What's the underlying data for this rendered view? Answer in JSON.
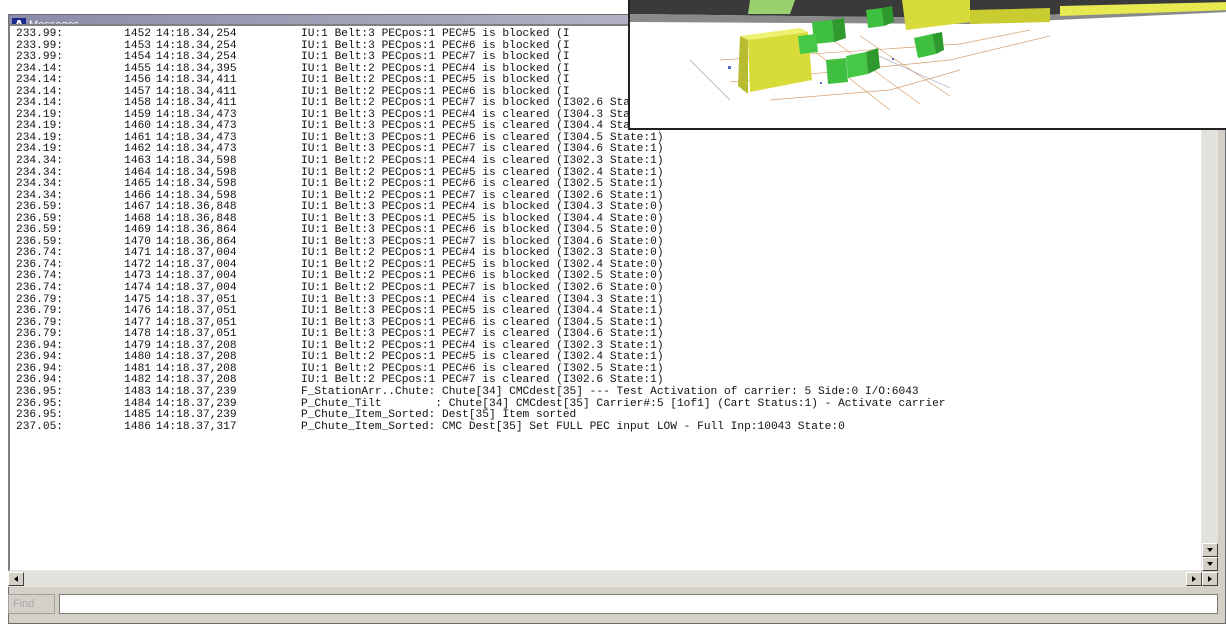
{
  "window": {
    "title": "Messages",
    "app_icon": "Λ"
  },
  "log": {
    "lines": [
      {
        "t": "233.99:",
        "n": "1452",
        "ts": "14:18.34,254",
        "msg": "IU:1 Belt:3 PECpos:1 PEC#5 is blocked (I"
      },
      {
        "t": "233.99:",
        "n": "1453",
        "ts": "14:18.34,254",
        "msg": "IU:1 Belt:3 PECpos:1 PEC#6 is blocked (I"
      },
      {
        "t": "233.99:",
        "n": "1454",
        "ts": "14:18.34,254",
        "msg": "IU:1 Belt:3 PECpos:1 PEC#7 is blocked (I"
      },
      {
        "t": "234.14:",
        "n": "1455",
        "ts": "14:18.34,395",
        "msg": "IU:1 Belt:2 PECpos:1 PEC#4 is blocked (I"
      },
      {
        "t": "234.14:",
        "n": "1456",
        "ts": "14:18.34,411",
        "msg": "IU:1 Belt:2 PECpos:1 PEC#5 is blocked (I"
      },
      {
        "t": "234.14:",
        "n": "1457",
        "ts": "14:18.34,411",
        "msg": "IU:1 Belt:2 PECpos:1 PEC#6 is blocked (I"
      },
      {
        "t": "234.14:",
        "n": "1458",
        "ts": "14:18.34,411",
        "msg": "IU:1 Belt:2 PECpos:1 PEC#7 is blocked (I302.6 State:0)"
      },
      {
        "t": "234.19:",
        "n": "1459",
        "ts": "14:18.34,473",
        "msg": "IU:1 Belt:3 PECpos:1 PEC#4 is cleared (I304.3 State:1)"
      },
      {
        "t": "234.19:",
        "n": "1460",
        "ts": "14:18.34,473",
        "msg": "IU:1 Belt:3 PECpos:1 PEC#5 is cleared (I304.4 State:1)"
      },
      {
        "t": "234.19:",
        "n": "1461",
        "ts": "14:18.34,473",
        "msg": "IU:1 Belt:3 PECpos:1 PEC#6 is cleared (I304.5 State:1)"
      },
      {
        "t": "234.19:",
        "n": "1462",
        "ts": "14:18.34,473",
        "msg": "IU:1 Belt:3 PECpos:1 PEC#7 is cleared (I304.6 State:1)"
      },
      {
        "t": "234.34:",
        "n": "1463",
        "ts": "14:18.34,598",
        "msg": "IU:1 Belt:2 PECpos:1 PEC#4 is cleared (I302.3 State:1)"
      },
      {
        "t": "234.34:",
        "n": "1464",
        "ts": "14:18.34,598",
        "msg": "IU:1 Belt:2 PECpos:1 PEC#5 is cleared (I302.4 State:1)"
      },
      {
        "t": "234.34:",
        "n": "1465",
        "ts": "14:18.34,598",
        "msg": "IU:1 Belt:2 PECpos:1 PEC#6 is cleared (I302.5 State:1)"
      },
      {
        "t": "234.34:",
        "n": "1466",
        "ts": "14:18.34,598",
        "msg": "IU:1 Belt:2 PECpos:1 PEC#7 is cleared (I302.6 State:1)"
      },
      {
        "t": "236.59:",
        "n": "1467",
        "ts": "14:18.36,848",
        "msg": "IU:1 Belt:3 PECpos:1 PEC#4 is blocked (I304.3 State:0)"
      },
      {
        "t": "236.59:",
        "n": "1468",
        "ts": "14:18.36,848",
        "msg": "IU:1 Belt:3 PECpos:1 PEC#5 is blocked (I304.4 State:0)"
      },
      {
        "t": "236.59:",
        "n": "1469",
        "ts": "14:18.36,864",
        "msg": "IU:1 Belt:3 PECpos:1 PEC#6 is blocked (I304.5 State:0)"
      },
      {
        "t": "236.59:",
        "n": "1470",
        "ts": "14:18.36,864",
        "msg": "IU:1 Belt:3 PECpos:1 PEC#7 is blocked (I304.6 State:0)"
      },
      {
        "t": "236.74:",
        "n": "1471",
        "ts": "14:18.37,004",
        "msg": "IU:1 Belt:2 PECpos:1 PEC#4 is blocked (I302.3 State:0)"
      },
      {
        "t": "236.74:",
        "n": "1472",
        "ts": "14:18.37,004",
        "msg": "IU:1 Belt:2 PECpos:1 PEC#5 is blocked (I302.4 State:0)"
      },
      {
        "t": "236.74:",
        "n": "1473",
        "ts": "14:18.37,004",
        "msg": "IU:1 Belt:2 PECpos:1 PEC#6 is blocked (I302.5 State:0)"
      },
      {
        "t": "236.74:",
        "n": "1474",
        "ts": "14:18.37,004",
        "msg": "IU:1 Belt:2 PECpos:1 PEC#7 is blocked (I302.6 State:0)"
      },
      {
        "t": "236.79:",
        "n": "1475",
        "ts": "14:18.37,051",
        "msg": "IU:1 Belt:3 PECpos:1 PEC#4 is cleared (I304.3 State:1)"
      },
      {
        "t": "236.79:",
        "n": "1476",
        "ts": "14:18.37,051",
        "msg": "IU:1 Belt:3 PECpos:1 PEC#5 is cleared (I304.4 State:1)"
      },
      {
        "t": "236.79:",
        "n": "1477",
        "ts": "14:18.37,051",
        "msg": "IU:1 Belt:3 PECpos:1 PEC#6 is cleared (I304.5 State:1)"
      },
      {
        "t": "236.79:",
        "n": "1478",
        "ts": "14:18.37,051",
        "msg": "IU:1 Belt:3 PECpos:1 PEC#7 is cleared (I304.6 State:1)"
      },
      {
        "t": "236.94:",
        "n": "1479",
        "ts": "14:18.37,208",
        "msg": "IU:1 Belt:2 PECpos:1 PEC#4 is cleared (I302.3 State:1)"
      },
      {
        "t": "236.94:",
        "n": "1480",
        "ts": "14:18.37,208",
        "msg": "IU:1 Belt:2 PECpos:1 PEC#5 is cleared (I302.4 State:1)"
      },
      {
        "t": "236.94:",
        "n": "1481",
        "ts": "14:18.37,208",
        "msg": "IU:1 Belt:2 PECpos:1 PEC#6 is cleared (I302.5 State:1)"
      },
      {
        "t": "236.94:",
        "n": "1482",
        "ts": "14:18.37,208",
        "msg": "IU:1 Belt:2 PECpos:1 PEC#7 is cleared (I302.6 State:1)"
      },
      {
        "t": "236.95:",
        "n": "1483",
        "ts": "14:18.37,239",
        "msg": "F_StationArr..Chute: Chute[34] CMCdest[35] --- Test Activation of carrier: 5 Side:0 I/O:6043"
      },
      {
        "t": "236.95:",
        "n": "1484",
        "ts": "14:18.37,239",
        "msg": "P_Chute_Tilt        : Chute[34] CMCdest[35] Carrier#:5 [1of1] (Cart Status:1) - Activate carrier"
      },
      {
        "t": "236.95:",
        "n": "1485",
        "ts": "14:18.37,239",
        "msg": "P_Chute_Item_Sorted: Dest[35] Item sorted"
      },
      {
        "t": "237.05:",
        "n": "1486",
        "ts": "14:18.37,317",
        "msg": "P_Chute_Item_Sorted: CMC Dest[35] Set FULL PEC input LOW - Full Inp:10043 State:0"
      }
    ]
  },
  "find": {
    "button_label": "Find",
    "input_value": ""
  },
  "icons": {
    "scroll_down": "triangle-down-icon",
    "scroll_left": "triangle-left-icon",
    "scroll_right": "triangle-right-icon"
  },
  "colors": {
    "box_yellow": "#d8dc4a",
    "box_green": "#3fbf3f",
    "title_gradient": "#8c8ca8"
  }
}
